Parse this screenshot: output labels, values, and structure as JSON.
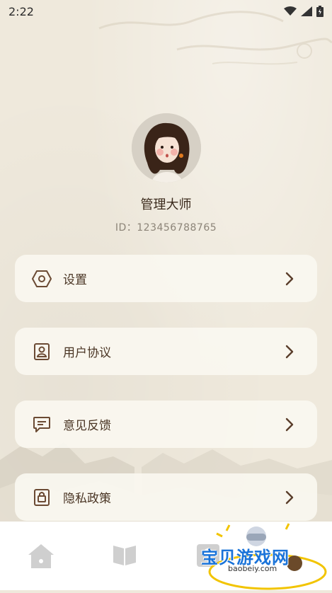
{
  "status_bar": {
    "time": "2:22"
  },
  "profile": {
    "name": "管理大师",
    "id_text": "ID：123456788765"
  },
  "menu": {
    "items": [
      {
        "label": "设置",
        "icon": "settings-hex-icon"
      },
      {
        "label": "用户协议",
        "icon": "user-agreement-icon"
      },
      {
        "label": "意见反馈",
        "icon": "feedback-icon"
      },
      {
        "label": "隐私政策",
        "icon": "privacy-policy-icon"
      }
    ]
  },
  "tab_bar": {
    "tabs": [
      {
        "icon": "home-icon"
      },
      {
        "icon": "book-icon"
      },
      {
        "icon": "profile-icon"
      }
    ]
  },
  "watermark": {
    "text": "宝贝游戏网",
    "url": "baobeiy.com"
  },
  "colors": {
    "background": "#efe9dc",
    "card": "#faf7f0",
    "text": "#4a3524",
    "accent_brown": "#6b4a33"
  }
}
